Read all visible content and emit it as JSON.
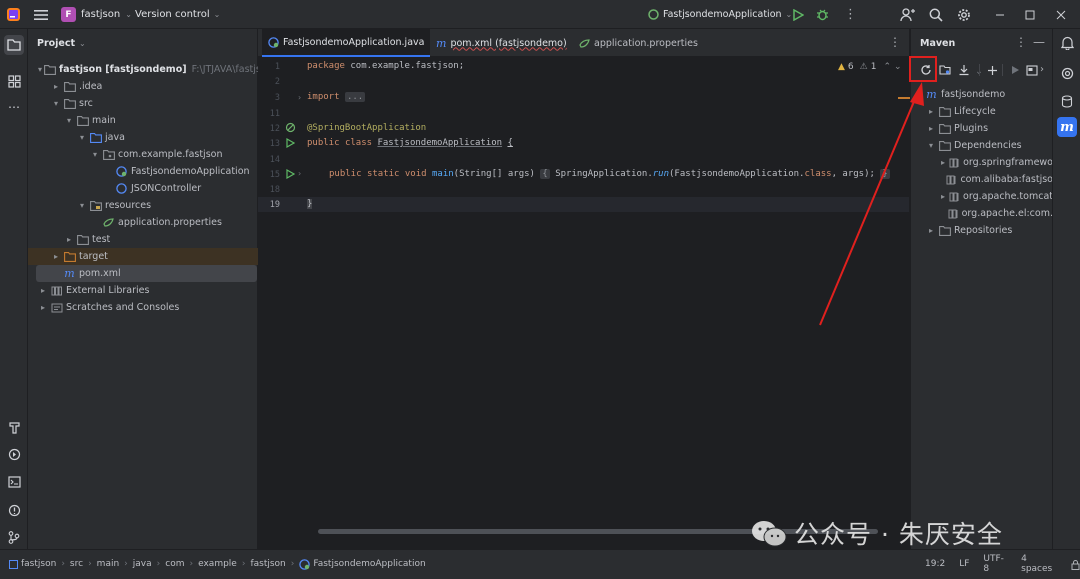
{
  "titlebar": {
    "project_badge": "F",
    "project_name": "fastjson",
    "vcs_label": "Version control",
    "run_config": "FastjsondemoApplication"
  },
  "project_panel": {
    "title": "Project",
    "tree": [
      {
        "label": "fastjson [fastjsondemo]",
        "suffix": "F:\\JTJAVA\\fastjson",
        "indent": 0,
        "arrow": "▾",
        "icon": "folder-icon"
      },
      {
        "label": ".idea",
        "indent": 1,
        "arrow": "▸",
        "icon": "folder-icon"
      },
      {
        "label": "src",
        "indent": 1,
        "arrow": "▾",
        "icon": "folder-icon"
      },
      {
        "label": "main",
        "indent": 2,
        "arrow": "▾",
        "icon": "folder-icon"
      },
      {
        "label": "java",
        "indent": 3,
        "arrow": "▾",
        "icon": "source-folder-icon"
      },
      {
        "label": "com.example.fastjson",
        "indent": 4,
        "arrow": "▾",
        "icon": "package-icon"
      },
      {
        "label": "FastjsondemoApplication",
        "indent": 5,
        "arrow": "",
        "icon": "spring-class-icon"
      },
      {
        "label": "JSONController",
        "indent": 5,
        "arrow": "",
        "icon": "class-icon"
      },
      {
        "label": "resources",
        "indent": 3,
        "arrow": "▾",
        "icon": "resources-folder-icon"
      },
      {
        "label": "application.properties",
        "indent": 4,
        "arrow": "",
        "icon": "properties-icon"
      },
      {
        "label": "test",
        "indent": 2,
        "arrow": "▸",
        "icon": "folder-icon"
      },
      {
        "label": "target",
        "indent": 1,
        "arrow": "▸",
        "icon": "excluded-folder-icon"
      },
      {
        "label": "pom.xml",
        "indent": 1,
        "arrow": "",
        "icon": "maven-icon"
      },
      {
        "label": "External Libraries",
        "indent": 0,
        "arrow": "▸",
        "icon": "library-icon"
      },
      {
        "label": "Scratches and Consoles",
        "indent": 0,
        "arrow": "▸",
        "icon": "scratch-icon"
      }
    ]
  },
  "editor": {
    "tabs": [
      {
        "label": "FastjsondemoApplication.java",
        "icon": "spring-class-icon"
      },
      {
        "label": "pom.xml (fastjsondemo)",
        "icon": "maven-icon"
      },
      {
        "label": "application.properties",
        "icon": "properties-icon"
      }
    ],
    "inspections": {
      "warnings": "6",
      "weak_warnings": "1"
    },
    "line_numbers": [
      "1",
      "2",
      "3",
      "11",
      "12",
      "13",
      "14",
      "15",
      "18",
      "19"
    ],
    "code": {
      "l1_kw": "package",
      "l1_rest": " com.example.fastjson;",
      "l3_kw": "import",
      "l3_fold": "...",
      "l12": "@SpringBootApplication",
      "l13_kw1": "public",
      "l13_kw2": "class",
      "l13_name": "FastjsondemoApplication",
      "l13_brace": "{",
      "l15_kw1": "public",
      "l15_kw2": "static",
      "l15_kw3": "void",
      "l15_fn": "main",
      "l15_args": "(String[] args)",
      "l15_fold_open": "{",
      "l15_body1": " SpringApplication.",
      "l15_body_fn": "run",
      "l15_body2": "(FastjsondemoApplication.",
      "l15_body_kw": "class",
      "l15_body3": ", args);",
      "l15_fold_close": "}",
      "l19": "}"
    }
  },
  "maven": {
    "title": "Maven",
    "tree": [
      {
        "label": "fastjsondemo",
        "indent": 0,
        "arrow": "▾",
        "icon": "maven-icon"
      },
      {
        "label": "Lifecycle",
        "indent": 1,
        "arrow": "▸",
        "icon": "lifecycle-folder-icon"
      },
      {
        "label": "Plugins",
        "indent": 1,
        "arrow": "▸",
        "icon": "plugins-folder-icon"
      },
      {
        "label": "Dependencies",
        "indent": 1,
        "arrow": "▾",
        "icon": "dependencies-folder-icon"
      },
      {
        "label": "org.springframewo",
        "indent": 2,
        "arrow": "▸",
        "icon": "dependency-icon"
      },
      {
        "label": "com.alibaba:fastjso",
        "indent": 2,
        "arrow": "",
        "icon": "dependency-icon"
      },
      {
        "label": "org.apache.tomcat",
        "indent": 2,
        "arrow": "▸",
        "icon": "dependency-icon"
      },
      {
        "label": "org.apache.el:com.",
        "indent": 2,
        "arrow": "",
        "icon": "dependency-icon"
      },
      {
        "label": "Repositories",
        "indent": 1,
        "arrow": "▸",
        "icon": "repositories-folder-icon"
      }
    ]
  },
  "statusbar": {
    "breadcrumbs": [
      "fastjson",
      "src",
      "main",
      "java",
      "com",
      "example",
      "fastjson",
      "FastjsondemoApplication"
    ],
    "position": "19:2",
    "line_ending": "LF",
    "encoding": "UTF-8",
    "indent": "4 spaces"
  },
  "watermark": {
    "text": "公众号 · 朱厌安全"
  },
  "colors": {
    "accent": "#3574f0",
    "highlight": "#e0201e"
  }
}
